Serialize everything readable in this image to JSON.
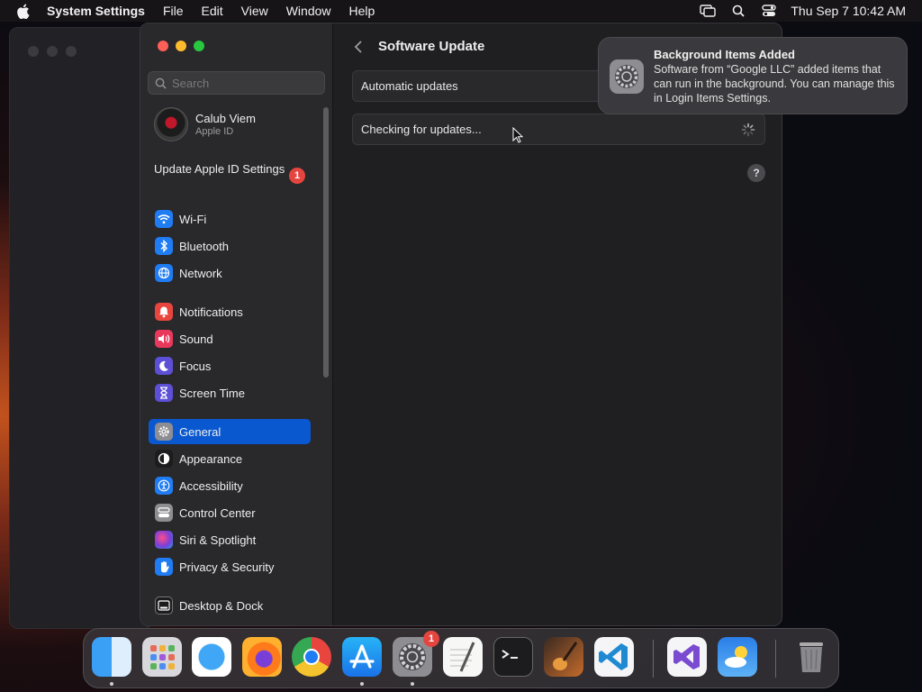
{
  "menubar": {
    "app_name": "System Settings",
    "menus": [
      "File",
      "Edit",
      "View",
      "Window",
      "Help"
    ],
    "clock": "Thu Sep 7  10:42 AM"
  },
  "sidebar": {
    "search_placeholder": "Search",
    "account": {
      "name": "Calub Viem",
      "subtitle": "Apple ID"
    },
    "update_apple_id": "Update Apple ID Settings",
    "update_badge": "1",
    "items": [
      {
        "label": "Wi-Fi",
        "icon": "wifi-icon",
        "color": "#1f7cf2"
      },
      {
        "label": "Bluetooth",
        "icon": "bluetooth-icon",
        "color": "#1f7cf2"
      },
      {
        "label": "Network",
        "icon": "globe-icon",
        "color": "#1f7cf2"
      },
      {
        "label": "Notifications",
        "icon": "bell-icon",
        "color": "#e8453f"
      },
      {
        "label": "Sound",
        "icon": "speaker-icon",
        "color": "#e8395c"
      },
      {
        "label": "Focus",
        "icon": "moon-icon",
        "color": "#5d4fd6"
      },
      {
        "label": "Screen Time",
        "icon": "hourglass-icon",
        "color": "#5d4fd6"
      },
      {
        "label": "General",
        "icon": "gear-icon",
        "color": "#8e8d92"
      },
      {
        "label": "Appearance",
        "icon": "appearance-icon",
        "color": "#1c1c1c"
      },
      {
        "label": "Accessibility",
        "icon": "accessibility-icon",
        "color": "#1f7cf2"
      },
      {
        "label": "Control Center",
        "icon": "control-center-icon",
        "color": "#8e8d92"
      },
      {
        "label": "Siri & Spotlight",
        "icon": "siri-icon",
        "color": "#7a3ed8"
      },
      {
        "label": "Privacy & Security",
        "icon": "hand-icon",
        "color": "#1f7cf2"
      },
      {
        "label": "Desktop & Dock",
        "icon": "dock-icon",
        "color": "#1c1c1c"
      }
    ]
  },
  "content": {
    "title": "Software Update",
    "automatic_updates": "Automatic updates",
    "checking": "Checking for updates...",
    "help": "?"
  },
  "notification": {
    "title": "Background Items Added",
    "body": "Software from “Google LLC” added items that can run in the background. You can manage this in Login Items Settings."
  },
  "dock": {
    "settings_badge": "1",
    "apps": [
      "Finder",
      "Launchpad",
      "Safari",
      "Firefox",
      "Chrome",
      "App Store",
      "System Settings",
      "TextEdit",
      "Terminal",
      "GarageBand",
      "Visual Studio Code",
      "Visual Studio",
      "Weather",
      "Trash"
    ]
  }
}
